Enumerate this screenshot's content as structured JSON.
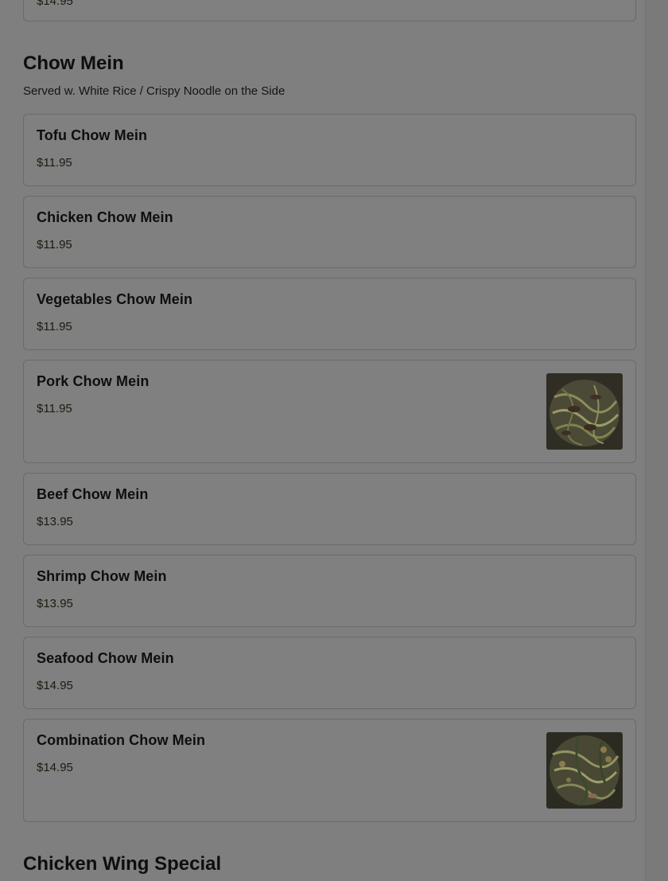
{
  "top_card": {
    "price": "$14.95"
  },
  "section": {
    "title": "Chow Mein",
    "description": "Served w. White Rice / Crispy Noodle on the Side"
  },
  "items": [
    {
      "name": "Tofu Chow Mein",
      "price": "$11.95"
    },
    {
      "name": "Chicken Chow Mein",
      "price": "$11.95"
    },
    {
      "name": "Vegetables Chow Mein",
      "price": "$11.95"
    },
    {
      "name": "Pork Chow Mein",
      "price": "$11.95"
    },
    {
      "name": "Beef Chow Mein",
      "price": "$13.95"
    },
    {
      "name": "Shrimp Chow Mein",
      "price": "$13.95"
    },
    {
      "name": "Seafood Chow Mein",
      "price": "$14.95"
    },
    {
      "name": "Combination Chow Mein",
      "price": "$14.95"
    }
  ],
  "next_section": {
    "title": "Chicken Wing Special"
  }
}
